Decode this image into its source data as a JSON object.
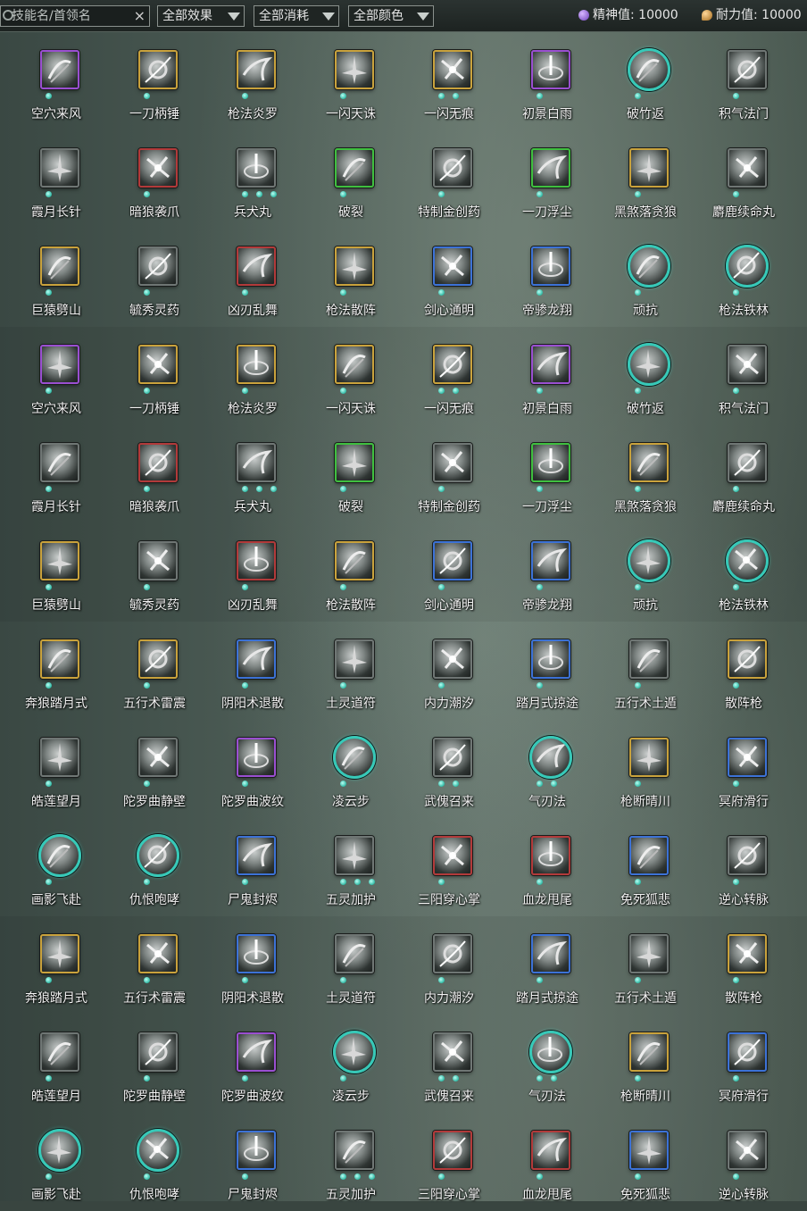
{
  "toolbar": {
    "search_placeholder": "技能名/首领名",
    "clear_label": "×",
    "filters": [
      "全部效果",
      "全部消耗",
      "全部颜色"
    ],
    "spirit_label": "精神值: 10000",
    "endurance_label": "耐力值: 10000"
  },
  "grid": {
    "rows": [
      [
        {
          "name": "空穴来风",
          "frame": "purple",
          "dots": 1
        },
        {
          "name": "一刀柄锤",
          "frame": "gold",
          "dots": 1
        },
        {
          "name": "枪法炎罗",
          "frame": "gold",
          "dots": 1
        },
        {
          "name": "一闪天诛",
          "frame": "gold",
          "dots": 1
        },
        {
          "name": "一闪无痕",
          "frame": "gold",
          "dots": 2
        },
        {
          "name": "初景白雨",
          "frame": "purple",
          "dots": 1
        },
        {
          "name": "破竹返",
          "frame": "circle",
          "dots": 1
        },
        {
          "name": "积气法门",
          "frame": "gray",
          "dots": 1
        }
      ],
      [
        {
          "name": "霞月长针",
          "frame": "gray",
          "dots": 1
        },
        {
          "name": "暗狼袭爪",
          "frame": "red",
          "dots": 1
        },
        {
          "name": "兵犬丸",
          "frame": "gray",
          "dots": 3
        },
        {
          "name": "破裂",
          "frame": "green",
          "dots": 1
        },
        {
          "name": "特制金创药",
          "frame": "gray",
          "dots": 1
        },
        {
          "name": "一刀浮尘",
          "frame": "green",
          "dots": 1
        },
        {
          "name": "黑煞落贪狼",
          "frame": "gold",
          "dots": 1
        },
        {
          "name": "麝鹿续命丸",
          "frame": "gray",
          "dots": 1
        }
      ],
      [
        {
          "name": "巨猿劈山",
          "frame": "gold",
          "dots": 1
        },
        {
          "name": "毓秀灵药",
          "frame": "gray",
          "dots": 1
        },
        {
          "name": "凶刃乱舞",
          "frame": "red",
          "dots": 1
        },
        {
          "name": "枪法散阵",
          "frame": "gold",
          "dots": 1
        },
        {
          "name": "剑心通明",
          "frame": "blue",
          "dots": 1
        },
        {
          "name": "帝骖龙翔",
          "frame": "blue",
          "dots": 1
        },
        {
          "name": "顽抗",
          "frame": "circle",
          "dots": 1
        },
        {
          "name": "枪法铁林",
          "frame": "circle",
          "dots": 1
        }
      ],
      [
        {
          "name": "空穴来风",
          "frame": "purple",
          "dots": 1
        },
        {
          "name": "一刀柄锤",
          "frame": "gold",
          "dots": 1
        },
        {
          "name": "枪法炎罗",
          "frame": "gold",
          "dots": 1
        },
        {
          "name": "一闪天诛",
          "frame": "gold",
          "dots": 1
        },
        {
          "name": "一闪无痕",
          "frame": "gold",
          "dots": 2
        },
        {
          "name": "初景白雨",
          "frame": "purple",
          "dots": 1
        },
        {
          "name": "破竹返",
          "frame": "circle",
          "dots": 1
        },
        {
          "name": "积气法门",
          "frame": "gray",
          "dots": 1
        }
      ],
      [
        {
          "name": "霞月长针",
          "frame": "gray",
          "dots": 1
        },
        {
          "name": "暗狼袭爪",
          "frame": "red",
          "dots": 1
        },
        {
          "name": "兵犬丸",
          "frame": "gray",
          "dots": 3
        },
        {
          "name": "破裂",
          "frame": "green",
          "dots": 1
        },
        {
          "name": "特制金创药",
          "frame": "gray",
          "dots": 1
        },
        {
          "name": "一刀浮尘",
          "frame": "green",
          "dots": 1
        },
        {
          "name": "黑煞落贪狼",
          "frame": "gold",
          "dots": 1
        },
        {
          "name": "麝鹿续命丸",
          "frame": "gray",
          "dots": 1
        }
      ],
      [
        {
          "name": "巨猿劈山",
          "frame": "gold",
          "dots": 1
        },
        {
          "name": "毓秀灵药",
          "frame": "gray",
          "dots": 1
        },
        {
          "name": "凶刃乱舞",
          "frame": "red",
          "dots": 1
        },
        {
          "name": "枪法散阵",
          "frame": "gold",
          "dots": 1
        },
        {
          "name": "剑心通明",
          "frame": "blue",
          "dots": 1
        },
        {
          "name": "帝骖龙翔",
          "frame": "blue",
          "dots": 1
        },
        {
          "name": "顽抗",
          "frame": "circle",
          "dots": 1
        },
        {
          "name": "枪法铁林",
          "frame": "circle",
          "dots": 1
        }
      ],
      [
        {
          "name": "奔狼踏月式",
          "frame": "gold",
          "dots": 1
        },
        {
          "name": "五行术雷震",
          "frame": "gold",
          "dots": 1
        },
        {
          "name": "阴阳术退散",
          "frame": "blue",
          "dots": 1
        },
        {
          "name": "土灵道符",
          "frame": "gray",
          "dots": 1
        },
        {
          "name": "内力潮汐",
          "frame": "gray",
          "dots": 1
        },
        {
          "name": "踏月式掠途",
          "frame": "blue",
          "dots": 1
        },
        {
          "name": "五行术土遁",
          "frame": "gray",
          "dots": 1
        },
        {
          "name": "散阵枪",
          "frame": "gold",
          "dots": 1
        }
      ],
      [
        {
          "name": "皓莲望月",
          "frame": "gray",
          "dots": 1
        },
        {
          "name": "陀罗曲静壁",
          "frame": "gray",
          "dots": 1
        },
        {
          "name": "陀罗曲波纹",
          "frame": "purple",
          "dots": 1
        },
        {
          "name": "凌云步",
          "frame": "circle",
          "dots": 1
        },
        {
          "name": "武傀召来",
          "frame": "gray",
          "dots": 2
        },
        {
          "name": "气刃法",
          "frame": "circle",
          "dots": 2
        },
        {
          "name": "枪断晴川",
          "frame": "gold",
          "dots": 1
        },
        {
          "name": "冥府滑行",
          "frame": "blue",
          "dots": 1
        }
      ],
      [
        {
          "name": "画影飞赴",
          "frame": "circle",
          "dots": 1
        },
        {
          "name": "仇恨咆哮",
          "frame": "circle",
          "dots": 1
        },
        {
          "name": "尸鬼封烬",
          "frame": "blue",
          "dots": 1
        },
        {
          "name": "五灵加护",
          "frame": "gray",
          "dots": 3
        },
        {
          "name": "三阳穿心掌",
          "frame": "red",
          "dots": 1
        },
        {
          "name": "血龙甩尾",
          "frame": "red",
          "dots": 1
        },
        {
          "name": "免死狐悲",
          "frame": "blue",
          "dots": 1
        },
        {
          "name": "逆心转脉",
          "frame": "gray",
          "dots": 1
        }
      ],
      [
        {
          "name": "奔狼踏月式",
          "frame": "gold",
          "dots": 1
        },
        {
          "name": "五行术雷震",
          "frame": "gold",
          "dots": 1
        },
        {
          "name": "阴阳术退散",
          "frame": "blue",
          "dots": 1
        },
        {
          "name": "土灵道符",
          "frame": "gray",
          "dots": 1
        },
        {
          "name": "内力潮汐",
          "frame": "gray",
          "dots": 1
        },
        {
          "name": "踏月式掠途",
          "frame": "blue",
          "dots": 1
        },
        {
          "name": "五行术土遁",
          "frame": "gray",
          "dots": 1
        },
        {
          "name": "散阵枪",
          "frame": "gold",
          "dots": 1
        }
      ],
      [
        {
          "name": "皓莲望月",
          "frame": "gray",
          "dots": 1
        },
        {
          "name": "陀罗曲静壁",
          "frame": "gray",
          "dots": 1
        },
        {
          "name": "陀罗曲波纹",
          "frame": "purple",
          "dots": 1
        },
        {
          "name": "凌云步",
          "frame": "circle",
          "dots": 1
        },
        {
          "name": "武傀召来",
          "frame": "gray",
          "dots": 2
        },
        {
          "name": "气刃法",
          "frame": "circle",
          "dots": 2
        },
        {
          "name": "枪断晴川",
          "frame": "gold",
          "dots": 1
        },
        {
          "name": "冥府滑行",
          "frame": "blue",
          "dots": 1
        }
      ],
      [
        {
          "name": "画影飞赴",
          "frame": "circle",
          "dots": 1
        },
        {
          "name": "仇恨咆哮",
          "frame": "circle",
          "dots": 1
        },
        {
          "name": "尸鬼封烬",
          "frame": "blue",
          "dots": 1
        },
        {
          "name": "五灵加护",
          "frame": "gray",
          "dots": 3
        },
        {
          "name": "三阳穿心掌",
          "frame": "red",
          "dots": 1
        },
        {
          "name": "血龙甩尾",
          "frame": "red",
          "dots": 1
        },
        {
          "name": "免死狐悲",
          "frame": "blue",
          "dots": 1
        },
        {
          "name": "逆心转脉",
          "frame": "gray",
          "dots": 1
        }
      ]
    ]
  }
}
